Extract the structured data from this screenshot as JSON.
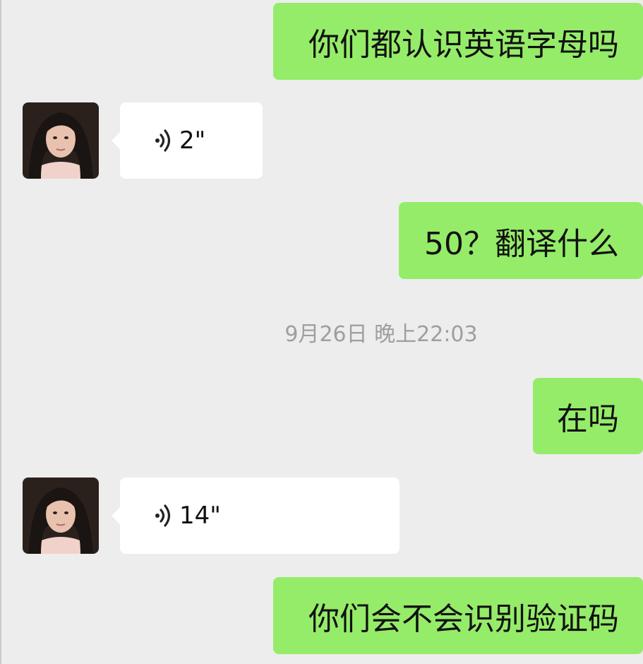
{
  "messages": [
    {
      "type": "outgoing",
      "text": "你们都认识英语字母吗"
    },
    {
      "type": "incoming-voice",
      "duration": "2\""
    },
    {
      "type": "outgoing",
      "text": "50？翻译什么"
    },
    {
      "type": "outgoing",
      "text": "在吗"
    },
    {
      "type": "incoming-voice",
      "duration": "14\""
    },
    {
      "type": "outgoing",
      "text": "你们会不会识别验证码"
    }
  ],
  "timestamp": "9月26日 晚上22:03",
  "colors": {
    "background": "#ededed",
    "outgoing_bubble": "#95ec69",
    "incoming_bubble": "#ffffff",
    "timestamp_text": "#9e9e9e"
  },
  "icons": {
    "voice": "voice-wave-icon",
    "avatar": "contact-avatar-photo"
  }
}
